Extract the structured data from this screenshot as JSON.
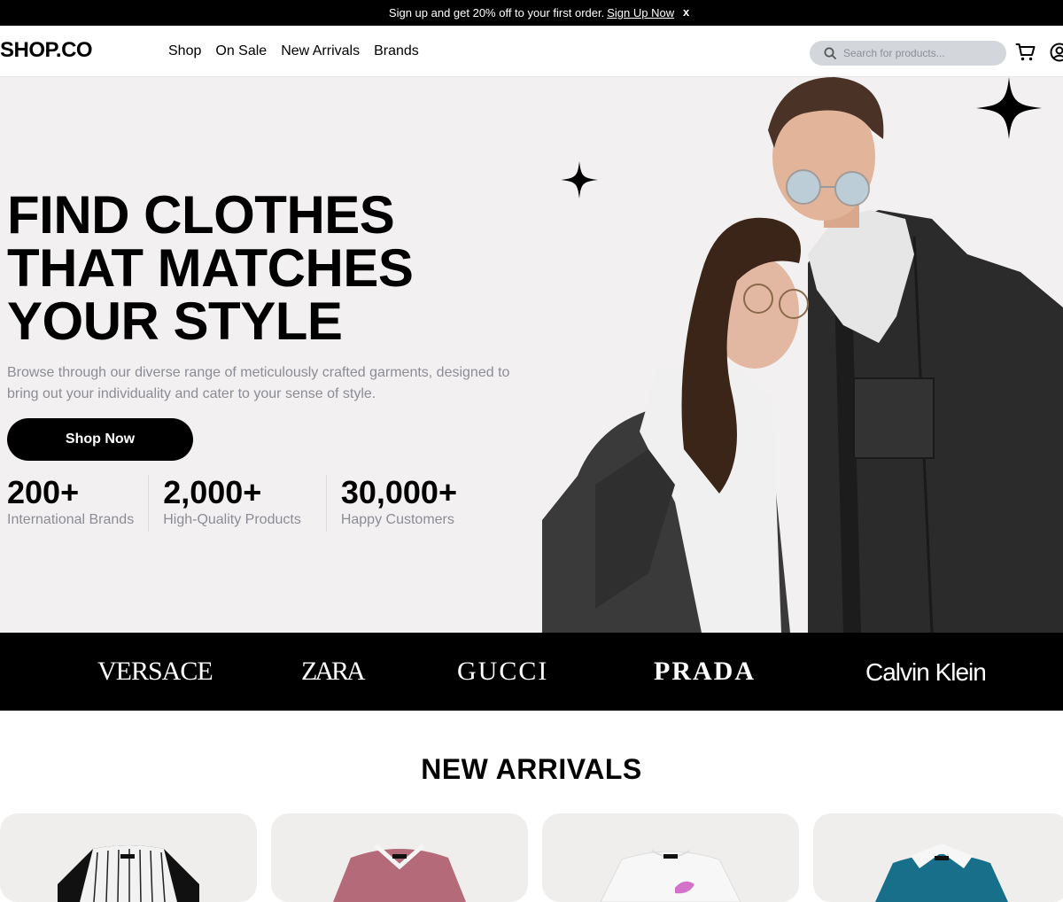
{
  "announcement": {
    "text": "Sign up and get 20% off to your first order.",
    "link": "Sign Up Now",
    "close": "x"
  },
  "header": {
    "logo": "SHOP.CO",
    "nav": [
      "Shop",
      "On Sale",
      "New Arrivals",
      "Brands"
    ],
    "search_placeholder": "Search for products...",
    "icons": [
      "search-icon",
      "cart-icon",
      "account-icon"
    ]
  },
  "hero": {
    "title_lines": [
      "FIND CLOTHES",
      "THAT MATCHES",
      "YOUR STYLE"
    ],
    "description": "Browse through our diverse range of meticulously crafted garments, designed to bring out your individuality and cater to your sense of style.",
    "cta": "Shop Now",
    "stats": [
      {
        "value": "200+",
        "label": "International Brands"
      },
      {
        "value": "2,000+",
        "label": "High-Quality Products"
      },
      {
        "value": "30,000+",
        "label": "Happy Customers"
      }
    ],
    "background_color": "#f2f0f1"
  },
  "brands": [
    "VERSACE",
    "ZARA",
    "GUCCI",
    "PRADA",
    "Calvin Klein"
  ],
  "new_arrivals": {
    "title": "NEW ARRIVALS",
    "products": [
      "raglan-striped-tshirt",
      "pink-polo-shirt",
      "white-graphic-tshirt",
      "teal-polo-shirt"
    ]
  },
  "colors": {
    "primary": "#000000",
    "muted_text": "#8c8c95",
    "search_bg": "#d3d6db",
    "card_bg": "#f0eeed"
  }
}
